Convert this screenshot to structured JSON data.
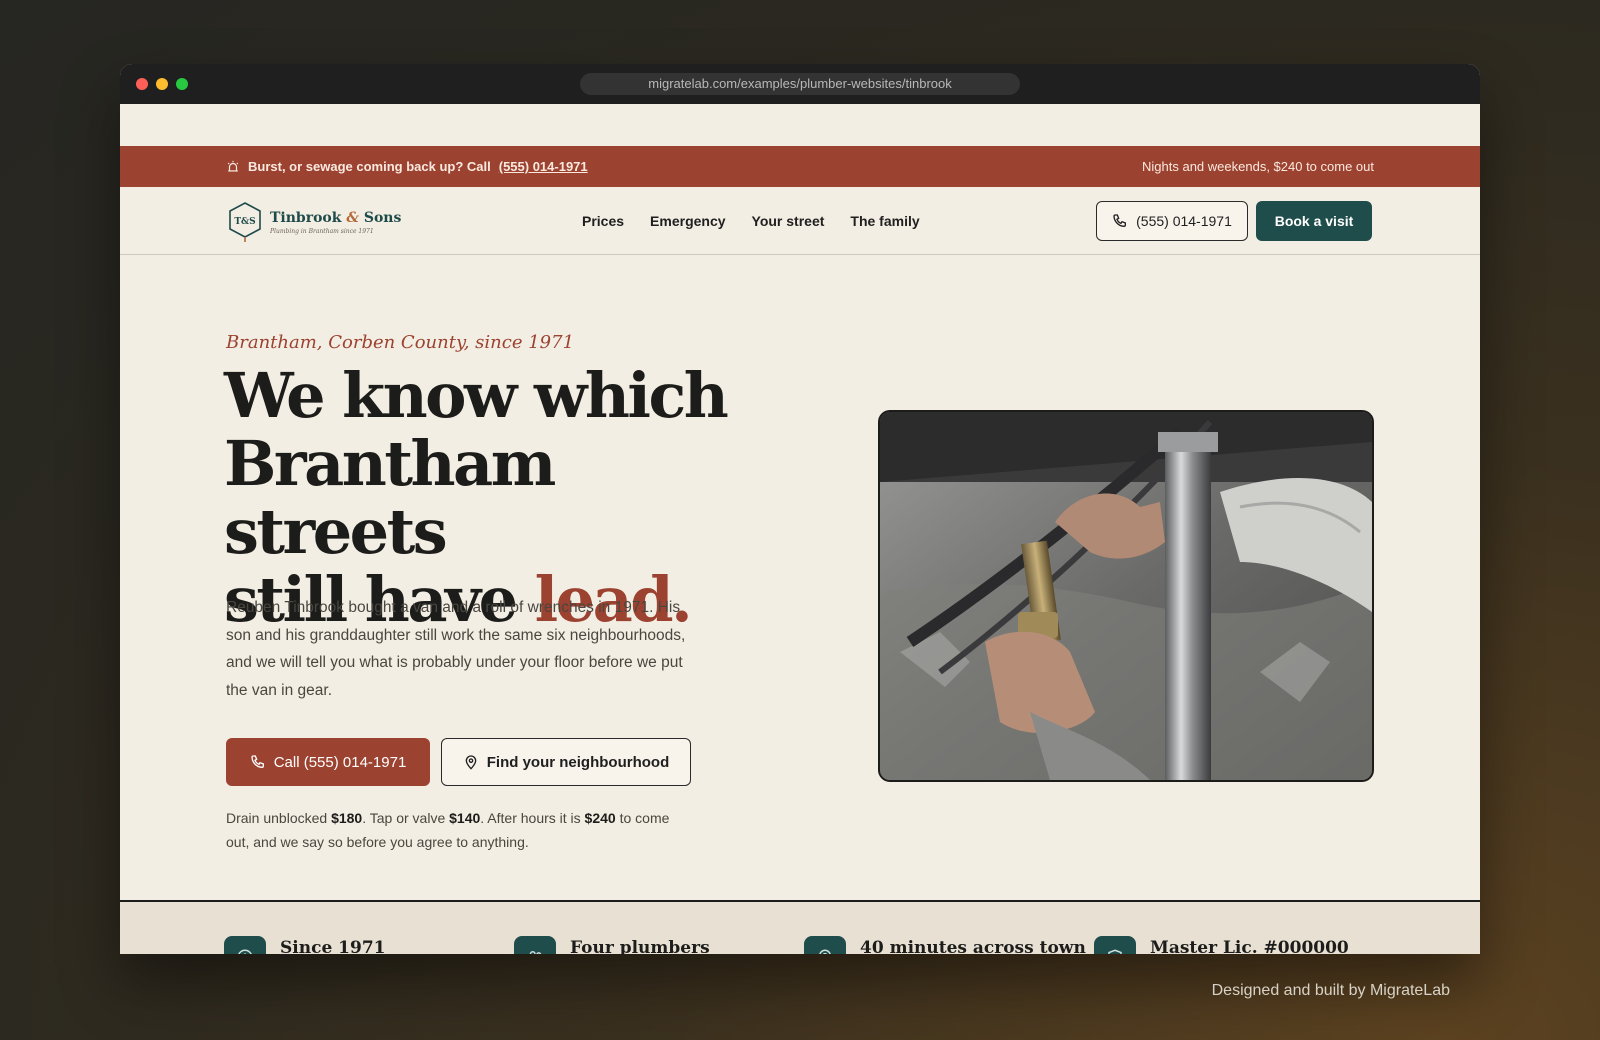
{
  "browser": {
    "url": "migratelab.com/examples/plumber-websites/tinbrook"
  },
  "alert": {
    "message": "Burst, or sewage coming back up? Call",
    "phone": "(555) 014-1971",
    "after_hours": "Nights and weekends, $240 to come out"
  },
  "nav": {
    "brand_name": "Tinbrook",
    "brand_amp": "&",
    "brand_sons": "Sons",
    "logo_monogram": "T&S",
    "tagline": "Plumbing in Brantham since 1971",
    "links": [
      "Prices",
      "Emergency",
      "Your street",
      "The family"
    ],
    "phone_button": "(555) 014-1971",
    "book_button": "Book a visit"
  },
  "hero": {
    "eyebrow": "Brantham, Corben County, since 1971",
    "headline_line1": "We know which",
    "headline_line2": "Brantham streets",
    "headline_line3": "still have",
    "headline_accent": "lead.",
    "lede": "Reuben Tinbrook bought a van and a roll of wrenches in 1971. His son and his granddaughter still work the same six neighbourhoods, and we will tell you what is probably under your floor before we put the van in gear.",
    "cta_call": "Call (555) 014-1971",
    "cta_find": "Find your neighbourhood",
    "prices": {
      "t1": "Drain unblocked ",
      "v1": "$180",
      "t2": ". Tap or valve ",
      "v2": "$140",
      "t3": ". After hours it is ",
      "v3": "$240",
      "t4": " to come out, and we say so before you agree to anything."
    }
  },
  "stats": [
    {
      "label": "Since 1971",
      "icon": "clock-icon"
    },
    {
      "label": "Four plumbers",
      "icon": "people-icon"
    },
    {
      "label": "40 minutes across town",
      "icon": "pin-icon"
    },
    {
      "label": "Master Lic. #000000",
      "icon": "shield-icon"
    }
  ],
  "footer": {
    "credit": "Designed and built by MigrateLab"
  },
  "colors": {
    "brick": "#9c4230",
    "teal": "#1f4d4b",
    "cream": "#f3eee3"
  }
}
